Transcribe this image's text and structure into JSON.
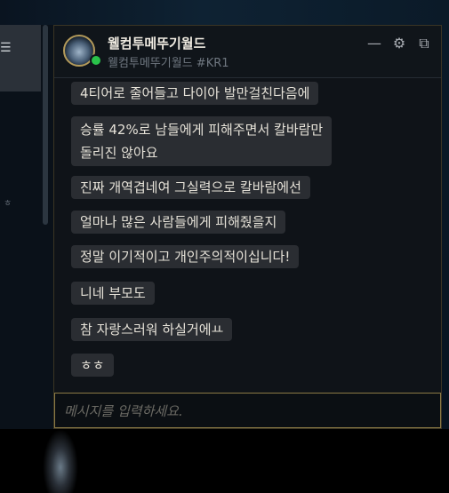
{
  "contact": {
    "name": "웰컴투메뚜기월드",
    "tag": "웰컴투메뚜기월드 #KR1",
    "status": "online"
  },
  "header_buttons": [
    {
      "name": "minimize",
      "glyph": "—"
    },
    {
      "name": "settings",
      "glyph": "⚙"
    },
    {
      "name": "pop-out",
      "glyph": "⧉"
    }
  ],
  "messages": [
    {
      "text": "4티어로 줄어들고 다이아 발만걸친다음에"
    },
    {
      "text": "승률 42%로 남들에게 피해주면서 칼바람만\n돌리진 않아요"
    },
    {
      "text": "진짜 개역겹네여 그실력으로 칼바람에선"
    },
    {
      "text": "얼마나 많은 사람들에게 피해줬을지"
    },
    {
      "text": "정말 이기적이고 개인주의적이십니다!"
    },
    {
      "text": "니네 부모도"
    },
    {
      "text": "참 자랑스러워 하실거에ㅛ"
    },
    {
      "text": "ㅎㅎ"
    }
  ],
  "input": {
    "placeholder": "메시지를 입력하세요.",
    "value": ""
  },
  "left_panel": {
    "menu_glyph": "☰",
    "small_text": "ㅎ"
  },
  "colors": {
    "status_online": "#29c24a",
    "input_border": "#8c7a45",
    "bubble": "#2a2d32"
  }
}
